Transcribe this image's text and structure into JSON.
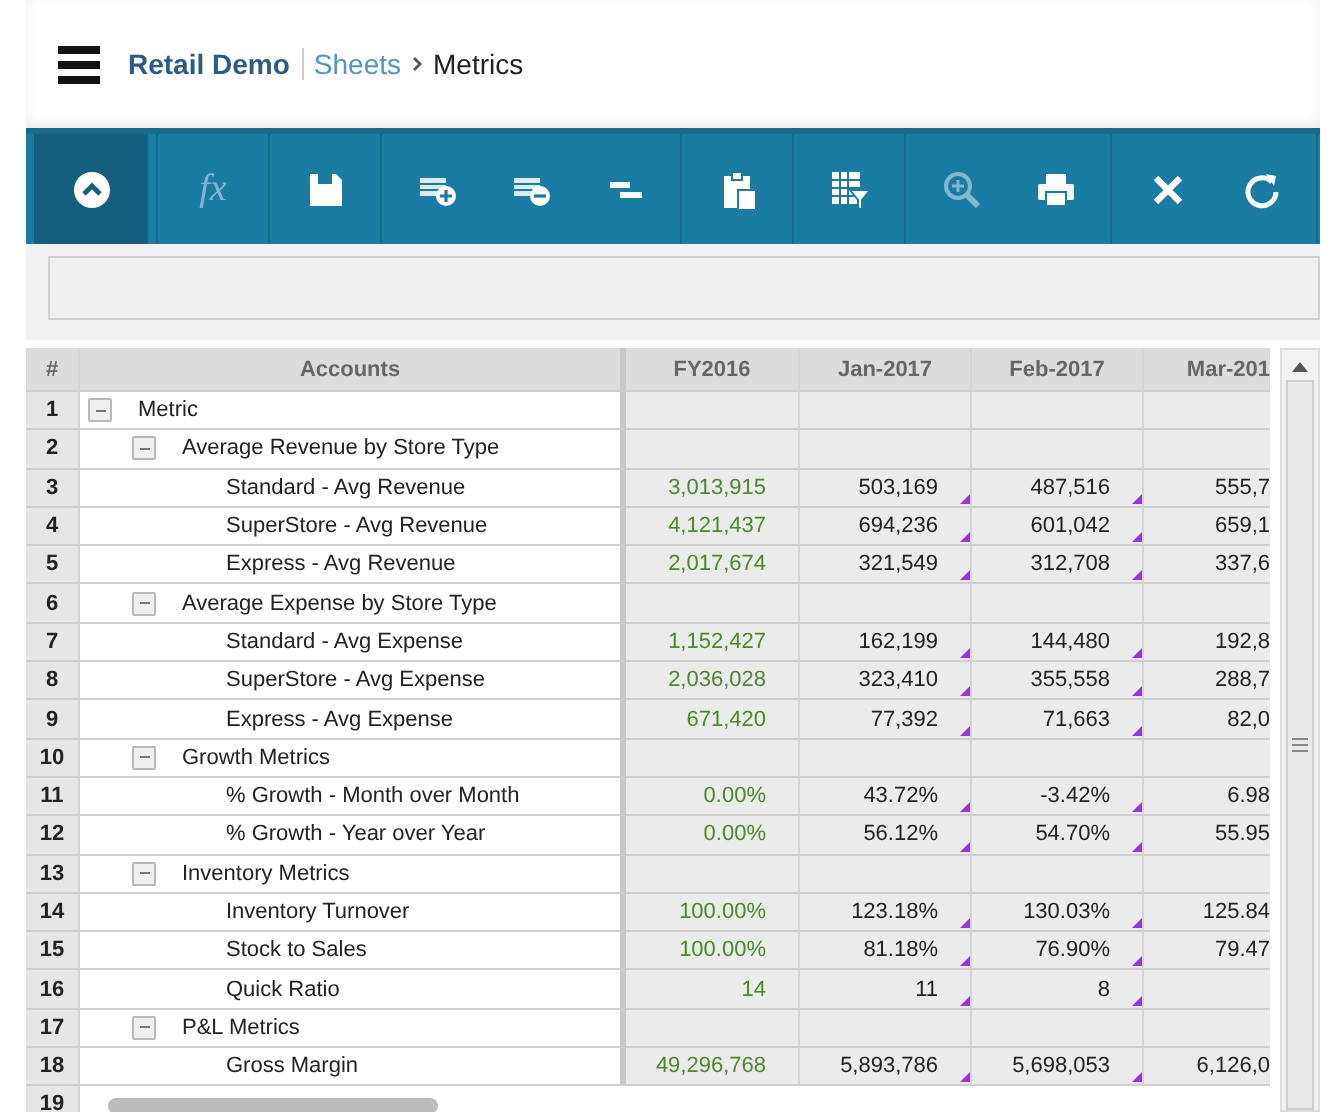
{
  "breadcrumb": [
    {
      "label": "Retail Demo",
      "kind": "app"
    },
    {
      "label": "Sheets",
      "kind": "link"
    },
    {
      "label": "Metrics",
      "kind": "current"
    }
  ],
  "toolbar": {
    "groups": [
      [
        {
          "kind": "collapse",
          "selected": true,
          "disabled": false
        }
      ],
      [
        {
          "kind": "formula",
          "glyph": "fx",
          "selected": false,
          "disabled": true
        }
      ],
      [
        {
          "kind": "save",
          "selected": false,
          "disabled": false
        }
      ],
      [
        {
          "kind": "insert-row",
          "selected": false,
          "disabled": false
        },
        {
          "kind": "delete-row",
          "selected": false,
          "disabled": false
        },
        {
          "kind": "outdent",
          "selected": false,
          "disabled": false
        }
      ],
      [
        {
          "kind": "paste-formula",
          "selected": false,
          "disabled": false
        }
      ],
      [
        {
          "kind": "grid-filter",
          "selected": false,
          "disabled": false
        }
      ],
      [
        {
          "kind": "zoom",
          "selected": false,
          "disabled": true
        },
        {
          "kind": "print",
          "selected": false,
          "disabled": false
        }
      ],
      [
        {
          "kind": "close",
          "selected": false,
          "disabled": false
        },
        {
          "kind": "refresh",
          "selected": false,
          "disabled": false
        }
      ]
    ]
  },
  "grid": {
    "row_number_header": "#",
    "tree_header": "Accounts",
    "columns": [
      {
        "label": "FY2016",
        "kind": "total"
      },
      {
        "label": "Jan-2017",
        "kind": "month",
        "flagged": true
      },
      {
        "label": "Feb-2017",
        "kind": "month",
        "flagged": true
      },
      {
        "label": "Mar-201",
        "kind": "month"
      }
    ],
    "rows": [
      {
        "number": "1",
        "label": "Metric",
        "expanded": true,
        "children": [
          {
            "number": "2",
            "label": "Average Revenue by Store Type",
            "expanded": true,
            "children": [
              {
                "number": "3",
                "label": "Standard - Avg Revenue",
                "values": [
                  "3,013,915",
                  "503,169",
                  "487,516",
                  "555,7"
                ]
              },
              {
                "number": "4",
                "label": "SuperStore - Avg Revenue",
                "values": [
                  "4,121,437",
                  "694,236",
                  "601,042",
                  "659,1"
                ]
              },
              {
                "number": "5",
                "label": "Express - Avg Revenue",
                "values": [
                  "2,017,674",
                  "321,549",
                  "312,708",
                  "337,6"
                ]
              }
            ]
          },
          {
            "number": "6",
            "label": "Average Expense by Store Type",
            "expanded": true,
            "children": [
              {
                "number": "7",
                "label": "Standard - Avg Expense",
                "values": [
                  "1,152,427",
                  "162,199",
                  "144,480",
                  "192,8"
                ]
              },
              {
                "number": "8",
                "label": "SuperStore - Avg Expense",
                "values": [
                  "2,036,028",
                  "323,410",
                  "355,558",
                  "288,7"
                ]
              },
              {
                "number": "9",
                "label": "Express - Avg Expense",
                "values": [
                  "671,420",
                  "77,392",
                  "71,663",
                  "82,0"
                ]
              }
            ]
          },
          {
            "number": "10",
            "label": "Growth Metrics",
            "expanded": true,
            "children": [
              {
                "number": "11",
                "label": "% Growth - Month over Month",
                "values": [
                  "0.00%",
                  "43.72%",
                  "-3.42%",
                  "6.98"
                ]
              },
              {
                "number": "12",
                "label": "% Growth - Year over Year",
                "values": [
                  "0.00%",
                  "56.12%",
                  "54.70%",
                  "55.95"
                ]
              }
            ]
          },
          {
            "number": "13",
            "label": "Inventory Metrics",
            "expanded": true,
            "children": [
              {
                "number": "14",
                "label": "Inventory Turnover",
                "values": [
                  "100.00%",
                  "123.18%",
                  "130.03%",
                  "125.84"
                ]
              },
              {
                "number": "15",
                "label": "Stock to Sales",
                "values": [
                  "100.00%",
                  "81.18%",
                  "76.90%",
                  "79.47"
                ]
              },
              {
                "number": "16",
                "label": "Quick Ratio",
                "values": [
                  "14",
                  "11",
                  "8"
                ]
              }
            ]
          },
          {
            "number": "17",
            "label": "P&L Metrics",
            "expanded": true,
            "children": [
              {
                "number": "18",
                "label": "Gross Margin",
                "values": [
                  "49,296,768",
                  "5,893,786",
                  "5,698,053",
                  "6,126,0"
                ]
              }
            ]
          }
        ]
      }
    ],
    "empty_row_numbers": [
      "19"
    ]
  }
}
